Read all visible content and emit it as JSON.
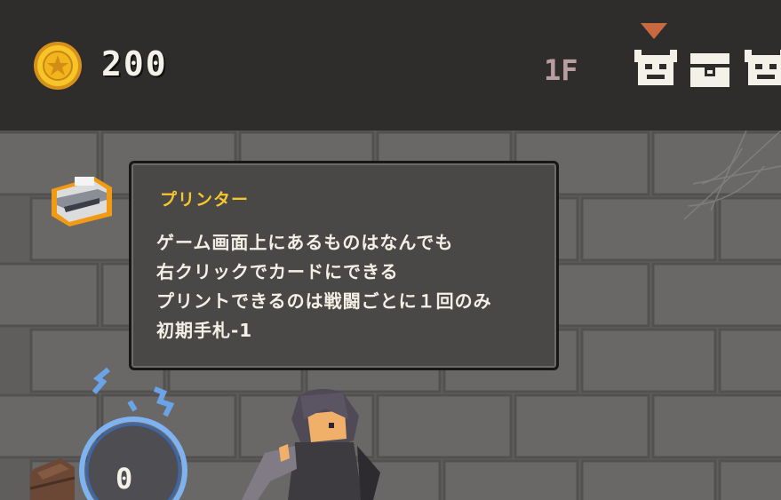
{
  "hud": {
    "gold": "200",
    "floor": "1F",
    "map_nodes": [
      "demon-icon",
      "chest-icon",
      "demon-icon"
    ]
  },
  "relic": {
    "icon": "printer-icon",
    "name": "プリンター",
    "description": [
      "ゲーム画面上にあるものはなんでも",
      "右クリックでカードにできる",
      "プリントできるのは戦闘ごとに１回のみ",
      "初期手札-1"
    ]
  },
  "energy": {
    "count": "0"
  },
  "colors": {
    "title": "#f6c62e",
    "text": "#f4f0e6",
    "panel": "#4a4847",
    "topbar": "#2e2d2c"
  }
}
